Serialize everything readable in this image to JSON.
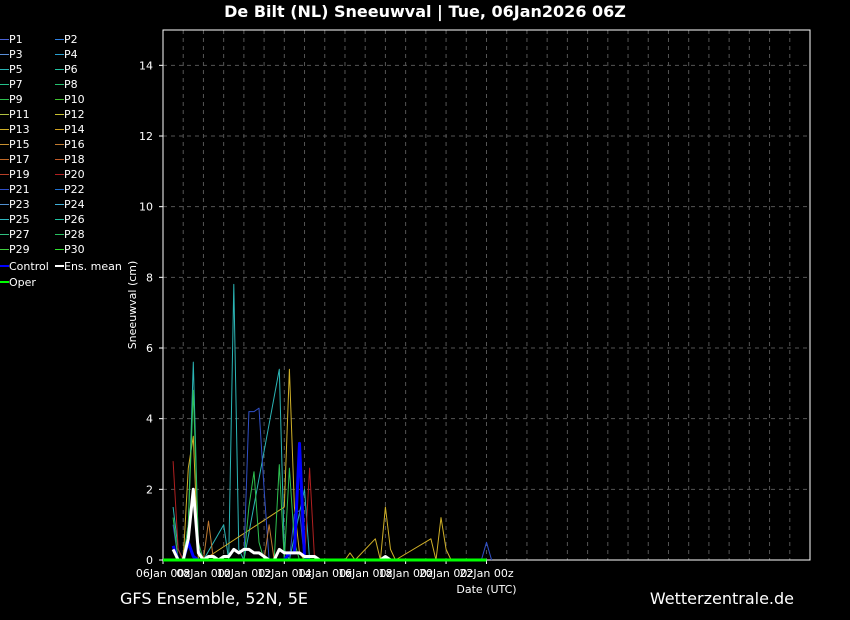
{
  "title": "De Bilt  (NL)  Sneeuwval | Tue, 06Jan2026 06Z",
  "footer_left": "GFS Ensemble, 52N, 5E",
  "footer_right": "Wetterzentrale.de",
  "colors": {
    "background": "#000000",
    "grid": "#555555",
    "axis": "#ffffff",
    "control": "#0000ff",
    "mean": "#ffffff",
    "oper": "#00ff00"
  },
  "legend": [
    {
      "label": "P1",
      "color": "#4a63d6"
    },
    {
      "label": "P2",
      "color": "#2f7fe0"
    },
    {
      "label": "P3",
      "color": "#5a8fd8"
    },
    {
      "label": "P4",
      "color": "#2aa0d0"
    },
    {
      "label": "P5",
      "color": "#2bb5b5"
    },
    {
      "label": "P6",
      "color": "#23c0a0"
    },
    {
      "label": "P7",
      "color": "#24c08a"
    },
    {
      "label": "P8",
      "color": "#25c070"
    },
    {
      "label": "P9",
      "color": "#2ec050"
    },
    {
      "label": "P10",
      "color": "#3fc030"
    },
    {
      "label": "P11",
      "color": "#b0c040"
    },
    {
      "label": "P12",
      "color": "#c8c030"
    },
    {
      "label": "P13",
      "color": "#d0b028"
    },
    {
      "label": "P14",
      "color": "#d0a020"
    },
    {
      "label": "P15",
      "color": "#c89030"
    },
    {
      "label": "P16",
      "color": "#c07a30"
    },
    {
      "label": "P17",
      "color": "#c06a28"
    },
    {
      "label": "P18",
      "color": "#c05a28"
    },
    {
      "label": "P19",
      "color": "#b84028"
    },
    {
      "label": "P20",
      "color": "#b02020"
    },
    {
      "label": "P21",
      "color": "#3050c8"
    },
    {
      "label": "P22",
      "color": "#2070d0"
    },
    {
      "label": "P23",
      "color": "#5090d0"
    },
    {
      "label": "P24",
      "color": "#40b0d8"
    },
    {
      "label": "P25",
      "color": "#30b8c0"
    },
    {
      "label": "P26",
      "color": "#20c0a0"
    },
    {
      "label": "P27",
      "color": "#30c080"
    },
    {
      "label": "P28",
      "color": "#28c060"
    },
    {
      "label": "P29",
      "color": "#40d040"
    },
    {
      "label": "P30",
      "color": "#30e030"
    },
    {
      "label": "Control",
      "color": "#0000ff"
    },
    {
      "label": "Ens. mean",
      "color": "#ffffff"
    },
    {
      "label": "Oper",
      "color": "#00ff00"
    }
  ],
  "chart_data": {
    "type": "line",
    "title": "De Bilt  (NL)  Sneeuwval | Tue, 06Jan2026 06Z",
    "xlabel": "Date (UTC)",
    "ylabel": "Sneeuwval (cm)",
    "xlim": [
      0,
      128
    ],
    "ylim": [
      0,
      15
    ],
    "x_unit": "hours since 06Jan 00z",
    "xticks": [
      {
        "label": "06Jan 00z",
        "x": 0
      },
      {
        "label": "08Jan 00z",
        "x": 8
      },
      {
        "label": "10Jan 00z",
        "x": 16
      },
      {
        "label": "12Jan 00z",
        "x": 24
      },
      {
        "label": "14Jan 00z",
        "x": 32
      },
      {
        "label": "16Jan 00z",
        "x": 40
      },
      {
        "label": "18Jan 00z",
        "x": 48
      },
      {
        "label": "20Jan 00z",
        "x": 56
      },
      {
        "label": "22Jan 00z",
        "x": 64
      }
    ],
    "yticks": [
      0,
      2,
      4,
      6,
      8,
      10,
      12,
      14
    ],
    "grid": true,
    "series": [
      {
        "name": "P5",
        "color": "#2bb5b5",
        "points": [
          [
            2,
            1.5
          ],
          [
            3,
            0.3
          ],
          [
            4,
            0
          ],
          [
            5,
            1
          ],
          [
            6,
            5.6
          ],
          [
            7,
            0.3
          ],
          [
            8,
            0
          ],
          [
            12,
            1
          ],
          [
            13,
            0
          ],
          [
            14,
            7.8
          ],
          [
            15,
            0.3
          ],
          [
            16,
            0
          ],
          [
            23,
            5.4
          ],
          [
            24,
            0.3
          ],
          [
            25,
            0
          ],
          [
            28,
            2
          ],
          [
            29,
            0
          ],
          [
            30,
            0
          ]
        ]
      },
      {
        "name": "P13",
        "color": "#d0b028",
        "points": [
          [
            2,
            0.3
          ],
          [
            3,
            0
          ],
          [
            4,
            0
          ],
          [
            5,
            2.6
          ],
          [
            6,
            3.5
          ],
          [
            7,
            0
          ],
          [
            8,
            0
          ],
          [
            24,
            1.5
          ],
          [
            25,
            5.4
          ],
          [
            26,
            1.5
          ],
          [
            27,
            0.2
          ],
          [
            28,
            0
          ],
          [
            36,
            0
          ],
          [
            37,
            0.2
          ],
          [
            38,
            0
          ],
          [
            42,
            0.6
          ],
          [
            43,
            0
          ],
          [
            44,
            1.5
          ],
          [
            45,
            0.3
          ],
          [
            46,
            0
          ],
          [
            53,
            0.6
          ],
          [
            54,
            0
          ],
          [
            55,
            1.2
          ],
          [
            56,
            0.3
          ],
          [
            57,
            0
          ]
        ]
      },
      {
        "name": "P20",
        "color": "#b02020",
        "points": [
          [
            2,
            2.8
          ],
          [
            3,
            0.3
          ],
          [
            4,
            0
          ],
          [
            8,
            0
          ],
          [
            28,
            0
          ],
          [
            29,
            2.6
          ],
          [
            30,
            0
          ]
        ]
      },
      {
        "name": "P21",
        "color": "#3050c8",
        "points": [
          [
            2,
            1
          ],
          [
            3,
            0
          ],
          [
            16,
            0
          ],
          [
            17,
            4.2
          ],
          [
            18,
            4.2
          ],
          [
            19,
            4.3
          ],
          [
            20,
            2
          ],
          [
            21,
            0
          ],
          [
            24,
            0
          ],
          [
            25,
            0
          ],
          [
            26,
            1.3
          ],
          [
            27,
            1.4
          ],
          [
            28,
            0
          ],
          [
            63,
            0
          ],
          [
            64,
            0.5
          ],
          [
            65,
            0
          ]
        ]
      },
      {
        "name": "P9",
        "color": "#2ec050",
        "points": [
          [
            2,
            1.2
          ],
          [
            3,
            0
          ],
          [
            4,
            0
          ],
          [
            5,
            1
          ],
          [
            6,
            4.8
          ],
          [
            7,
            0.5
          ],
          [
            8,
            0
          ],
          [
            16,
            0
          ],
          [
            17,
            1.5
          ],
          [
            18,
            2.5
          ],
          [
            19,
            0.5
          ],
          [
            20,
            0
          ],
          [
            22,
            0
          ],
          [
            23,
            2.7
          ],
          [
            24,
            0
          ],
          [
            25,
            2.6
          ],
          [
            26,
            0.5
          ],
          [
            27,
            0
          ]
        ]
      },
      {
        "name": "P16",
        "color": "#c07a30",
        "points": [
          [
            8,
            0
          ],
          [
            9,
            1.1
          ],
          [
            10,
            0
          ],
          [
            20,
            0
          ],
          [
            21,
            1
          ],
          [
            22,
            0
          ],
          [
            24,
            0
          ]
        ]
      },
      {
        "name": "Control",
        "color": "#0000ff",
        "width": 3,
        "points": [
          [
            2,
            0.4
          ],
          [
            3,
            0
          ],
          [
            4,
            0
          ],
          [
            5,
            0.5
          ],
          [
            6,
            0.1
          ],
          [
            7,
            0
          ],
          [
            24,
            0
          ],
          [
            25,
            0.2
          ],
          [
            26,
            0.2
          ],
          [
            27,
            3.3
          ],
          [
            28,
            0.1
          ],
          [
            29,
            0
          ],
          [
            30,
            0
          ]
        ]
      },
      {
        "name": "Ens. mean",
        "color": "#ffffff",
        "width": 3,
        "points": [
          [
            2,
            0.3
          ],
          [
            3,
            0
          ],
          [
            4,
            0
          ],
          [
            5,
            0.6
          ],
          [
            6,
            2
          ],
          [
            7,
            0.2
          ],
          [
            8,
            0
          ],
          [
            9,
            0.1
          ],
          [
            10,
            0.1
          ],
          [
            11,
            0
          ],
          [
            12,
            0.1
          ],
          [
            13,
            0.1
          ],
          [
            14,
            0.3
          ],
          [
            15,
            0.2
          ],
          [
            16,
            0.3
          ],
          [
            17,
            0.3
          ],
          [
            18,
            0.2
          ],
          [
            19,
            0.2
          ],
          [
            20,
            0.1
          ],
          [
            21,
            0
          ],
          [
            22,
            0
          ],
          [
            23,
            0.3
          ],
          [
            24,
            0.2
          ],
          [
            25,
            0.2
          ],
          [
            26,
            0.2
          ],
          [
            27,
            0.2
          ],
          [
            28,
            0.1
          ],
          [
            29,
            0.1
          ],
          [
            30,
            0.1
          ],
          [
            31,
            0
          ],
          [
            43,
            0
          ],
          [
            44,
            0.1
          ],
          [
            45,
            0
          ],
          [
            64,
            0
          ]
        ]
      },
      {
        "name": "Oper",
        "color": "#00ff00",
        "width": 3,
        "points": [
          [
            0,
            0
          ],
          [
            64,
            0
          ]
        ]
      }
    ]
  }
}
